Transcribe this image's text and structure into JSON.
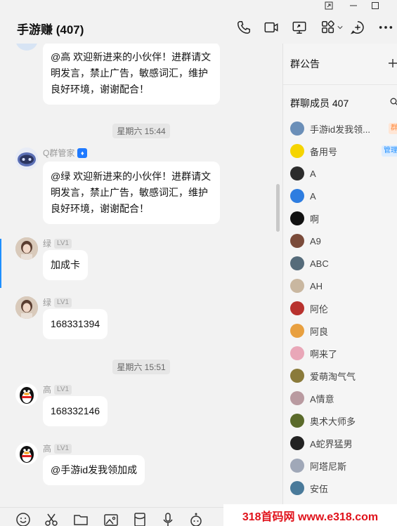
{
  "window": {
    "title": "手游赚 (407)"
  },
  "messages": [
    {
      "text": "@高 欢迎新进来的小伙伴！进群请文明发言，禁止广告，敏感词汇，维护良好环境，谢谢配合！"
    },
    {
      "timestamp": "星期六 15:44"
    },
    {
      "sender": "Q群管家",
      "text": "@绿 欢迎新进来的小伙伴！进群请文明发言，禁止广告，敏感词汇，维护良好环境，谢谢配合！"
    },
    {
      "sender": "绿",
      "level": "LV1",
      "text": "加成卡"
    },
    {
      "sender": "绿",
      "level": "LV1",
      "text": "168331394"
    },
    {
      "timestamp": "星期六 15:51"
    },
    {
      "sender": "高",
      "level": "LV1",
      "text": "168332146"
    },
    {
      "sender": "高",
      "level": "LV1",
      "text": "@手游id发我领加成"
    }
  ],
  "panel": {
    "announcement_label": "群公告",
    "members_label": "群聊成员 407",
    "members": [
      {
        "name": "手游id发我领...",
        "role": "群主",
        "color": "#6b8fb8"
      },
      {
        "name": "备用号",
        "role": "管理员",
        "color": "#f5d400"
      },
      {
        "name": "A",
        "color": "#2c2c2c"
      },
      {
        "name": "A",
        "color": "#2e7de0"
      },
      {
        "name": "啊",
        "color": "#111111"
      },
      {
        "name": "A9",
        "color": "#7a4b3a"
      },
      {
        "name": "ABC",
        "color": "#556b7a"
      },
      {
        "name": "AH",
        "color": "#c9b7a0"
      },
      {
        "name": "阿伦",
        "color": "#b8322e"
      },
      {
        "name": "阿良",
        "color": "#e8a040"
      },
      {
        "name": "啊来了",
        "color": "#e9a7b8"
      },
      {
        "name": "爱萌淘气气",
        "color": "#8a7a3a"
      },
      {
        "name": "A情意",
        "color": "#b99aa0"
      },
      {
        "name": "奥术大师多",
        "color": "#5a6a2a"
      },
      {
        "name": "A蛇界猛男",
        "color": "#222222"
      },
      {
        "name": "阿塔尼斯",
        "color": "#a0a8b8"
      },
      {
        "name": "安伍",
        "color": "#4a7a9a"
      }
    ]
  },
  "watermark": "318首码网 www.e318.com",
  "colors": {
    "accent": "#1f8fff",
    "owner_badge": "#ff8a3d",
    "admin_badge": "#1f8fff"
  }
}
